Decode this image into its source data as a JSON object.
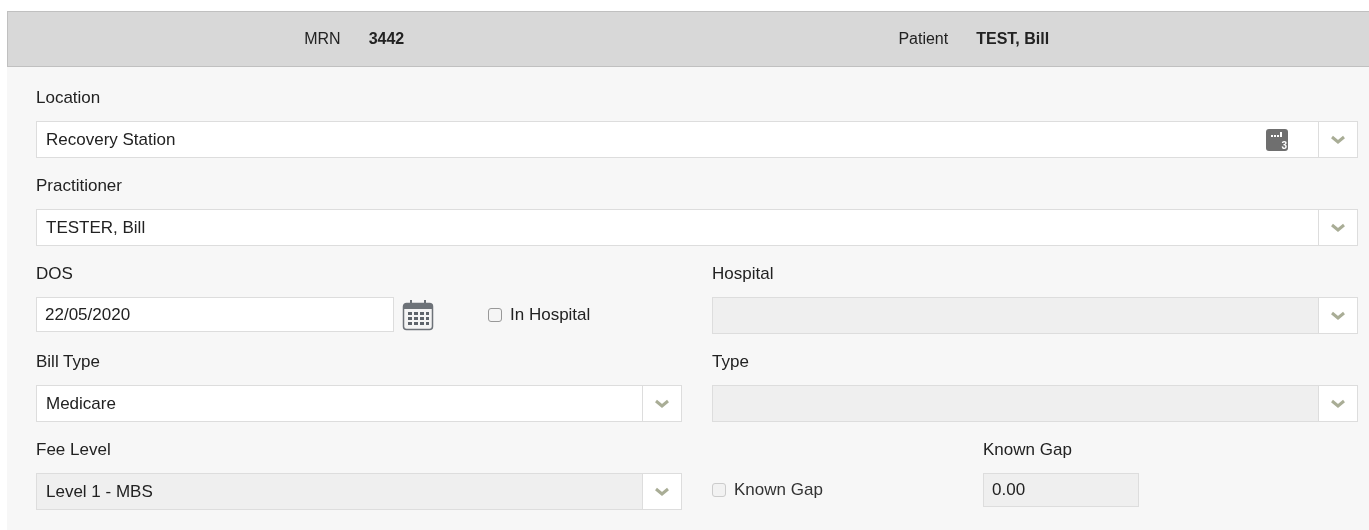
{
  "header": {
    "mrn_label": "MRN",
    "mrn": "3442",
    "patient_label": "Patient",
    "patient": "TEST, Bill"
  },
  "location": {
    "label": "Location",
    "value": "Recovery Station",
    "count": "3",
    "disabled": false
  },
  "practitioner": {
    "label": "Practitioner",
    "value": "TESTER, Bill",
    "disabled": false
  },
  "dos": {
    "label": "DOS",
    "value": "22/05/2020"
  },
  "in_hospital": {
    "label": "In Hospital",
    "checked": false,
    "disabled": false
  },
  "hospital": {
    "label": "Hospital",
    "disabled": true
  },
  "bill_type": {
    "label": "Bill Type",
    "value": "Medicare",
    "disabled": false
  },
  "type": {
    "label": "Type",
    "disabled": true
  },
  "fee_level": {
    "label": "Fee Level",
    "value": "Level 1 - MBS",
    "disabled": true
  },
  "known_gap_check": {
    "label": "Known Gap",
    "checked": false,
    "disabled": true
  },
  "known_gap": {
    "label": "Known Gap",
    "value": "0.00",
    "disabled": true
  }
}
